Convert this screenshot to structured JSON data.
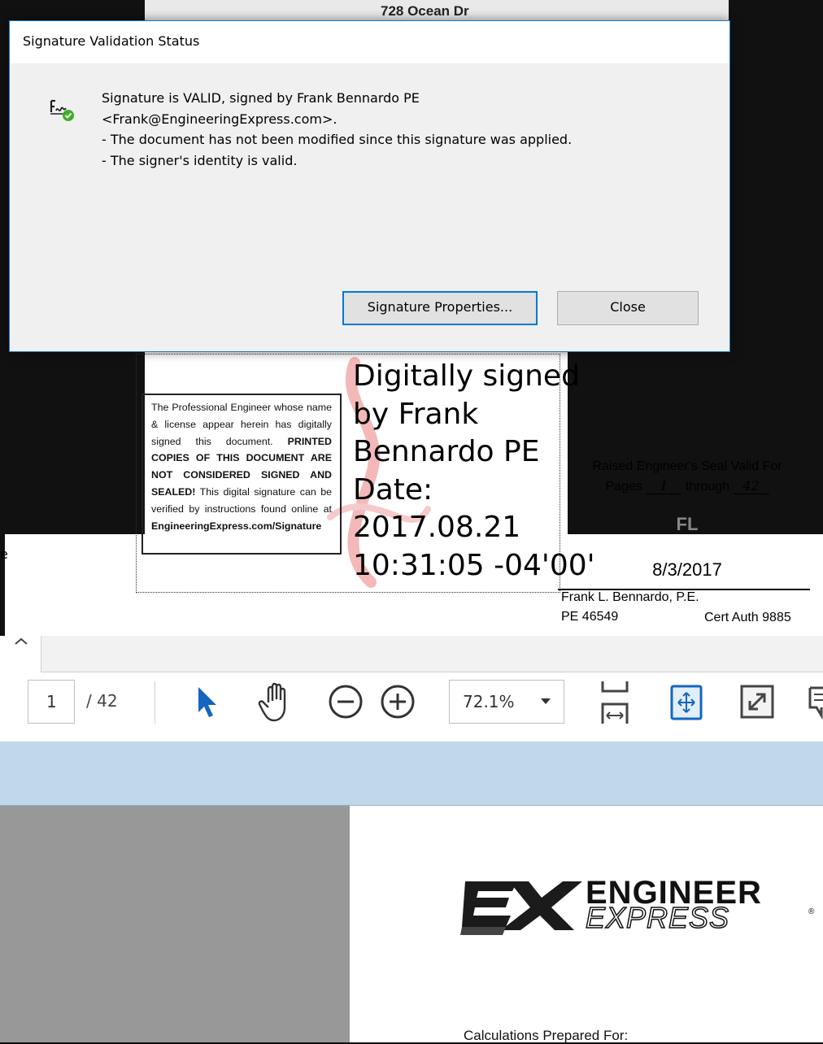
{
  "background_doc": {
    "partial_text": "728 Ocean Dr"
  },
  "dialog": {
    "title": "Signature Validation Status",
    "message_lines": [
      "Signature is VALID, signed by Frank Bennardo PE",
      "<Frank@EngineeringExpress.com>.",
      "- The document has not been modified since this signature was applied.",
      "- The signer's identity is valid."
    ],
    "buttons": {
      "properties": "Signature Properties...",
      "close": "Close"
    }
  },
  "signature_block": {
    "notice_parts": [
      "The Professional Engineer whose name & license appear herein has digitally signed this document. ",
      "PRINTED COPIES OF THIS DOCUMENT ARE NOT CONSIDERED SIGNED AND SEALED!",
      " This digital signature can be verified by instructions found online at ",
      "EngineeringExpress.com/Signature"
    ],
    "signed_lines": [
      "Digitally signed",
      "by Frank",
      "Bennardo PE",
      "Date:",
      "2017.08.21",
      "10:31:05 -04'00'"
    ]
  },
  "seal_block": {
    "line1": "Raised Engineer's Seal Valid For",
    "pages_label": "Pages",
    "pages_from": "1",
    "through_label": "through",
    "pages_to": "42",
    "state": "FL",
    "date": "8/3/2017",
    "name": "Frank L. Bennardo, P.E.",
    "pe_number": "PE 46549",
    "cert_auth": "Cert Auth 9885"
  },
  "left_edge_glyph": "e",
  "toolbar": {
    "page_current": "1",
    "page_total": "/ 42",
    "zoom": "72.1%",
    "icons": [
      "select-arrow-icon",
      "hand-tool-icon",
      "zoom-out-icon",
      "zoom-in-icon",
      "fit-page-icon",
      "scrolling-mode-icon",
      "full-screen-icon",
      "comment-icon"
    ]
  },
  "page_content": {
    "logo_line1": "ENGINEER",
    "logo_line2": "EXPRESS",
    "logo_reg": "®",
    "calc_prepared": "Calculations Prepared For:"
  },
  "colors": {
    "dialog_accent": "#0078d7",
    "blue_band": "#bfd9ea",
    "gray_panel": "#989898",
    "valid_check": "#3fae29"
  }
}
